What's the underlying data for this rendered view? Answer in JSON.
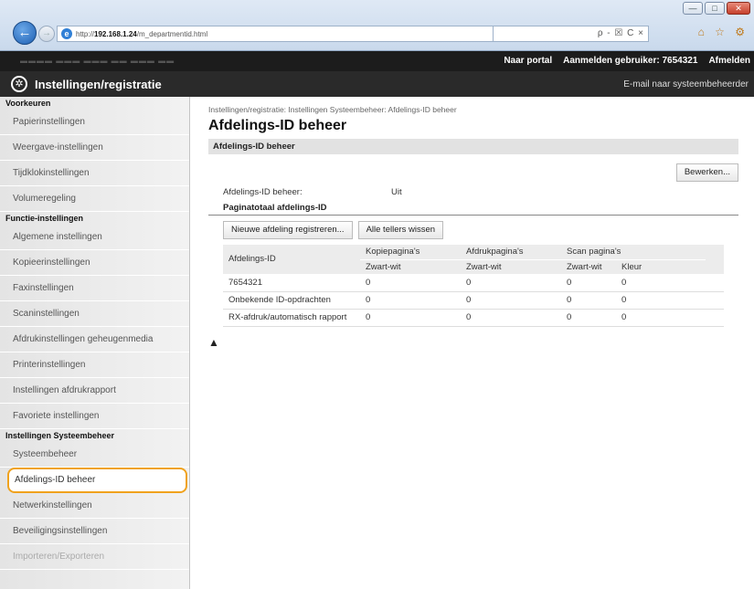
{
  "browser": {
    "back_icon": "arrow-left-icon",
    "forward_icon": "arrow-right-icon",
    "url_prefix": "http://",
    "url_host": "192.168.1.24",
    "url_path": "/m_departmentid.html",
    "search_text": "ρ - ☒ C ×",
    "toolbar_icons": "⌂ ☆ ⚙"
  },
  "topbar": {
    "portal_link": "Naar portal",
    "user_label": "Aanmelden gebruiker:",
    "user_value": "7654321",
    "logout_link": "Afmelden"
  },
  "header": {
    "title": "Instellingen/registratie",
    "mail_link": "E-mail naar systeembeheerder"
  },
  "sidebar": {
    "heading_preferences": "Voorkeuren",
    "items_preferences": [
      "Papierinstellingen",
      "Weergave-instellingen",
      "Tijdklokinstellingen",
      "Volumeregeling"
    ],
    "heading_functions": "Functie-instellingen",
    "items_functions": [
      "Algemene instellingen",
      "Kopieerinstellingen",
      "Faxinstellingen",
      "Scaninstellingen",
      "Afdrukinstellingen geheugenmedia",
      "Printerinstellingen",
      "Instellingen afdrukrapport",
      "Favoriete instellingen"
    ],
    "heading_system": "Instellingen Systeembeheer",
    "items_system": [
      "Systeembeheer",
      "Afdelings-ID beheer",
      "Netwerkinstellingen",
      "Beveiligingsinstellingen",
      "Importeren/Exporteren"
    ]
  },
  "main": {
    "breadcrumb": "Instellingen/registratie: Instellingen Systeembeheer: Afdelings-ID beheer",
    "title": "Afdelings-ID beheer",
    "section_title": "Afdelings-ID beheer",
    "edit_button": "Bewerken...",
    "status_label": "Afdelings-ID beheer:",
    "status_value": "Uit",
    "subsection_title": "Paginatotaal afdelings-ID",
    "register_button": "Nieuwe afdeling registreren...",
    "clear_button": "Alle tellers wissen",
    "table": {
      "col_id": "Afdelings-ID",
      "col_copy": "Kopiepagina's",
      "col_print": "Afdrukpagina's",
      "col_scan": "Scan pagina's",
      "sub_bw1": "Zwart-wit",
      "sub_bw2": "Zwart-wit",
      "sub_bw3": "Zwart-wit",
      "sub_color": "Kleur",
      "rows": [
        [
          "7654321",
          "0",
          "0",
          "0",
          "0"
        ],
        [
          "Onbekende ID-opdrachten",
          "0",
          "0",
          "0",
          "0"
        ],
        [
          "RX-afdruk/automatisch rapport",
          "0",
          "0",
          "0",
          "0"
        ]
      ]
    },
    "top_link": "▲"
  }
}
